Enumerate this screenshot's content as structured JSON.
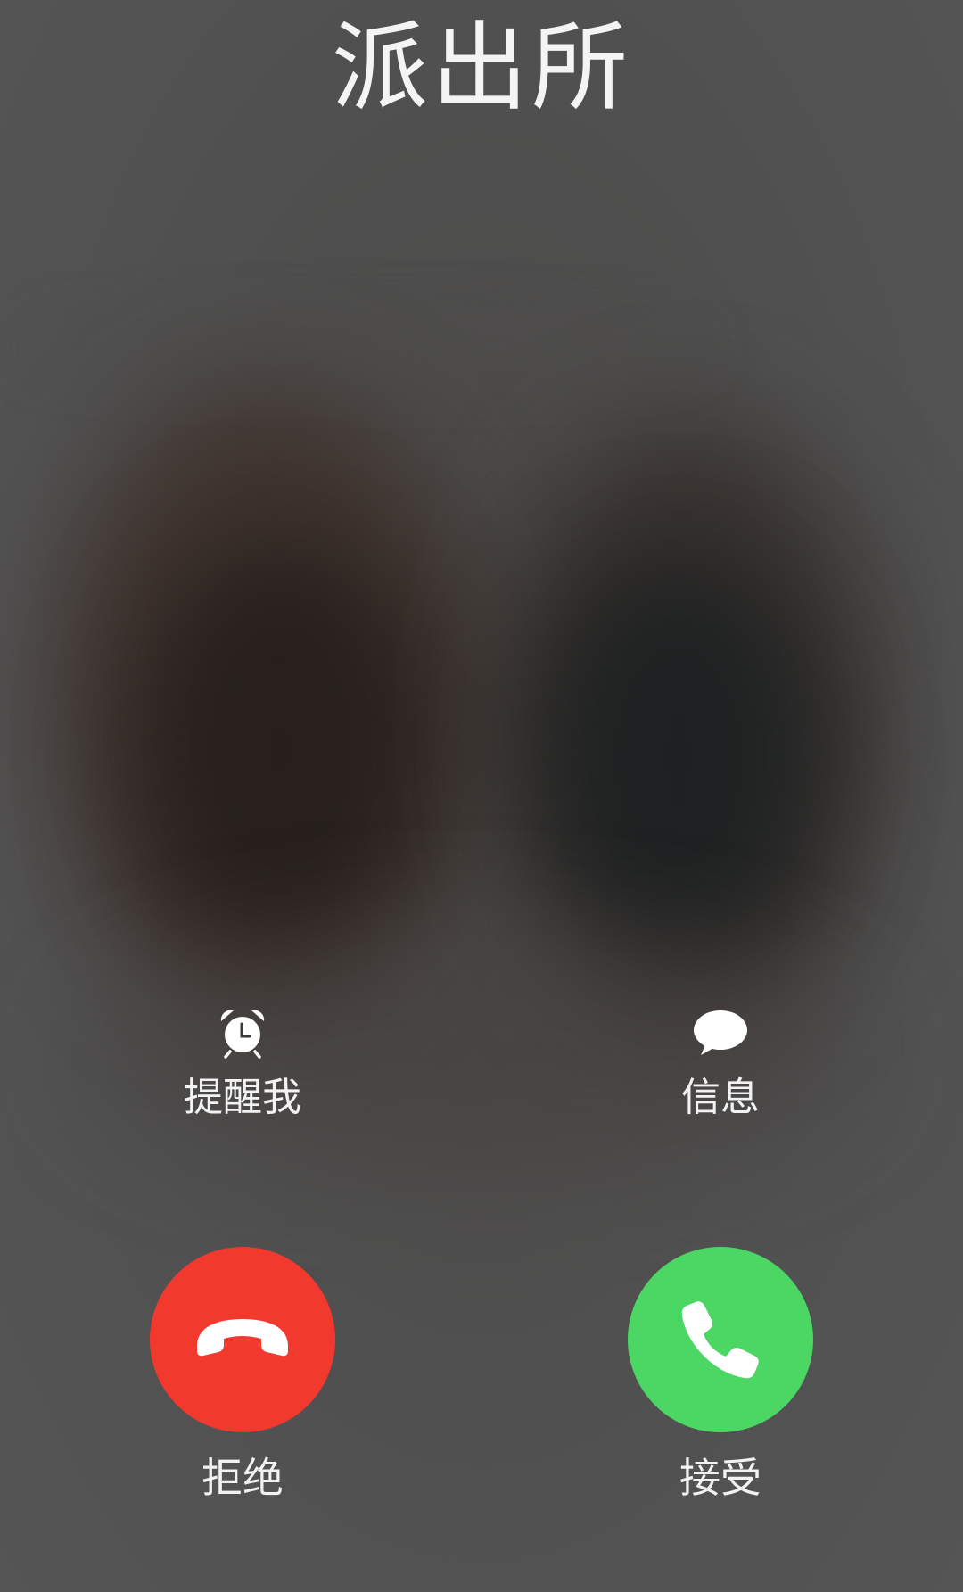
{
  "call": {
    "caller_name": "派出所"
  },
  "options": {
    "remind_me": {
      "label": "提醒我",
      "icon": "alarm-clock-icon"
    },
    "message": {
      "label": "信息",
      "icon": "message-bubble-icon"
    }
  },
  "actions": {
    "decline": {
      "label": "拒绝",
      "icon": "phone-hangup-icon",
      "color": "#f1392e"
    },
    "accept": {
      "label": "接受",
      "icon": "phone-icon",
      "color": "#4cd664"
    }
  }
}
